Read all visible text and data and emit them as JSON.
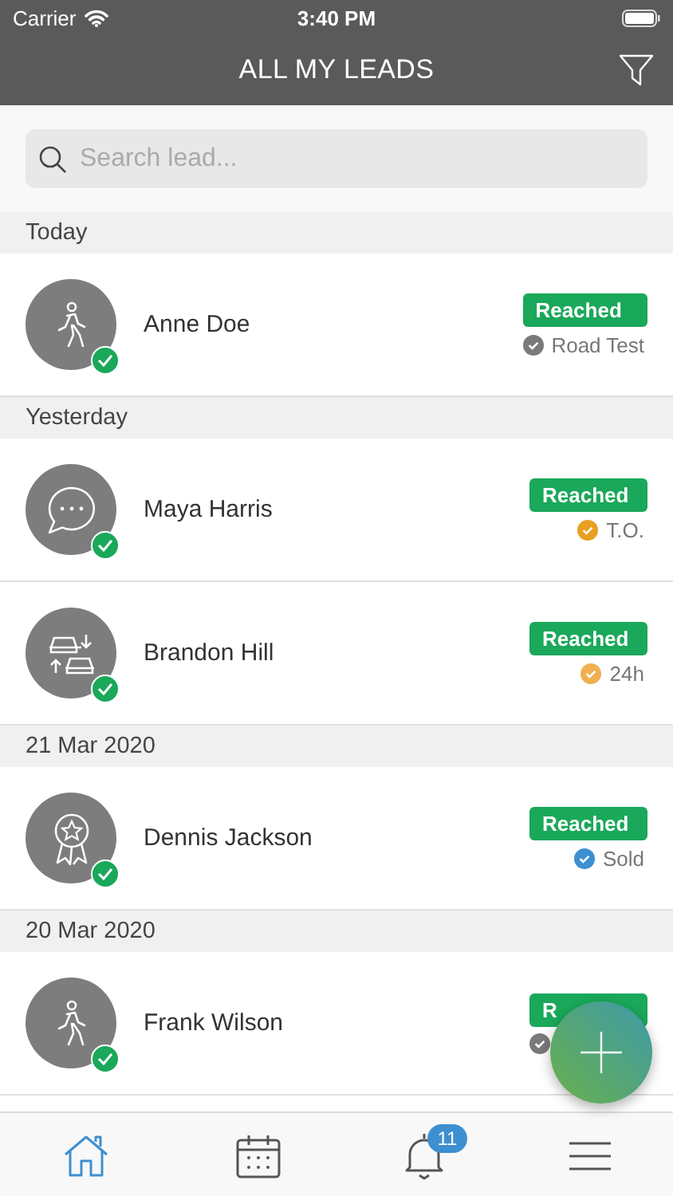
{
  "status_bar": {
    "carrier": "Carrier",
    "time": "3:40 PM"
  },
  "header": {
    "title": "ALL MY LEADS"
  },
  "search": {
    "placeholder": "Search lead..."
  },
  "sections": [
    {
      "label": "Today",
      "leads": [
        {
          "name": "Anne Doe",
          "kind": "walker",
          "status": "Reached",
          "stage": "Road Test",
          "color": "#7a7a7a"
        }
      ]
    },
    {
      "label": "Yesterday",
      "leads": [
        {
          "name": "Maya Harris",
          "kind": "chat",
          "status": "Reached",
          "stage": "T.O.",
          "color": "#e8a020"
        },
        {
          "name": "Brandon Hill",
          "kind": "cars",
          "status": "Reached",
          "stage": "24h",
          "color": "#f0b050"
        }
      ]
    },
    {
      "label": "21 Mar 2020",
      "leads": [
        {
          "name": "Dennis Jackson",
          "kind": "award",
          "status": "Reached",
          "stage": "Sold",
          "color": "#3d8fd0"
        }
      ]
    },
    {
      "label": "20 Mar 2020",
      "leads": [
        {
          "name": "Frank Wilson",
          "kind": "walker",
          "status": "R",
          "color": "#7a7a7a"
        }
      ]
    }
  ],
  "tab_bar": [
    {
      "kind": "home",
      "selected": true
    },
    {
      "kind": "calendar",
      "selected": false
    },
    {
      "kind": "bell",
      "selected": false,
      "badge": "11"
    },
    {
      "kind": "menu",
      "selected": false
    }
  ]
}
